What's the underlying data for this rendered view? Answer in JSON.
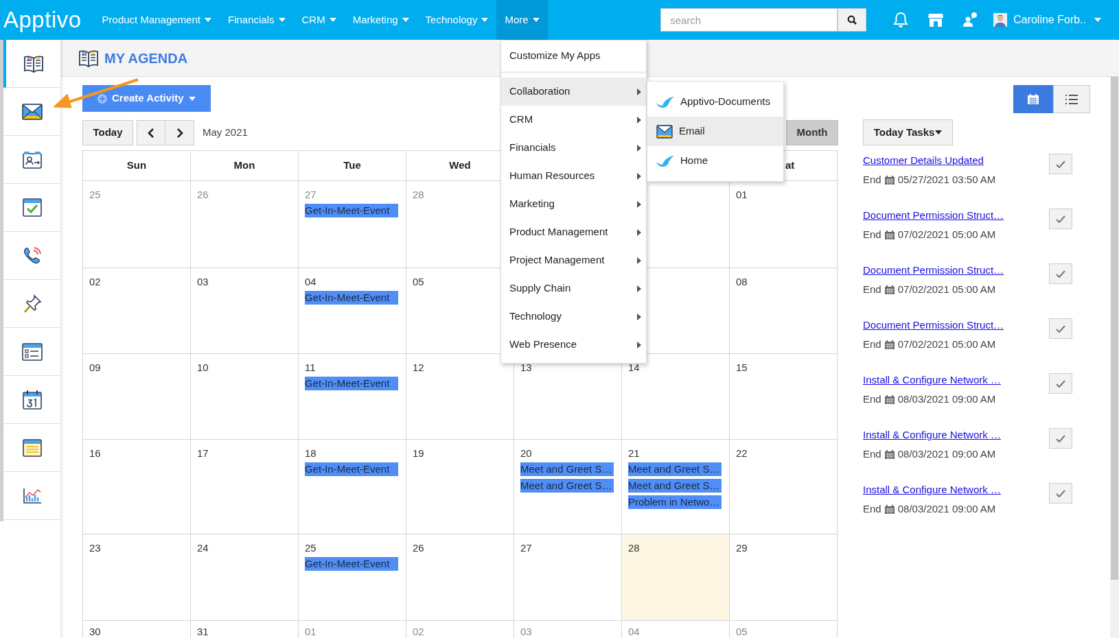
{
  "top_bar": {
    "logo": "Apptivo",
    "nav": [
      {
        "label": "Product Management",
        "selected": false
      },
      {
        "label": "Financials",
        "selected": false
      },
      {
        "label": "CRM",
        "selected": false
      },
      {
        "label": "Marketing",
        "selected": false
      },
      {
        "label": "Technology",
        "selected": false
      },
      {
        "label": "More",
        "selected": true
      }
    ],
    "search": {
      "placeholder": "search"
    },
    "user": "Caroline Forb.."
  },
  "sidebar": {
    "items": [
      {
        "kind": "book",
        "selected": true
      },
      {
        "kind": "mail",
        "selected": false
      },
      {
        "kind": "contacts",
        "selected": false
      },
      {
        "kind": "task",
        "selected": false
      },
      {
        "kind": "phone",
        "selected": false
      },
      {
        "kind": "pin",
        "selected": false
      },
      {
        "kind": "form",
        "selected": false
      },
      {
        "kind": "calendar",
        "selected": false
      },
      {
        "kind": "notepad",
        "selected": false
      },
      {
        "kind": "chart",
        "selected": false
      }
    ]
  },
  "page_title": "MY AGENDA",
  "toolbar": {
    "create_button": "Create Activity",
    "today_button": "Today",
    "period": "May 2021",
    "view_button": "Month"
  },
  "calendar": {
    "weekdays": [
      {
        "label": "Sun"
      },
      {
        "label": "Mon"
      },
      {
        "label": "Tue"
      },
      {
        "label": "Wed"
      },
      {
        "kind": "sat",
        "label": "at"
      }
    ],
    "weeks": [
      [
        {
          "date": "25",
          "muted": true
        },
        {
          "date": "26",
          "muted": true
        },
        {
          "date": "27",
          "muted": true,
          "events": [
            "Get-In-Meet-Event"
          ]
        },
        {
          "date": "28",
          "muted": true
        },
        {
          "kind": "sat",
          "date": "01",
          "muted": false
        }
      ],
      [
        {
          "date": "02",
          "muted": false
        },
        {
          "date": "03",
          "muted": false
        },
        {
          "date": "04",
          "muted": false,
          "events": [
            "Get-In-Meet-Event"
          ]
        },
        {
          "date": "05",
          "muted": false
        },
        {
          "kind": "sat",
          "date": "08",
          "muted": false
        }
      ],
      [
        {
          "date": "09",
          "muted": false
        },
        {
          "date": "10",
          "muted": false
        },
        {
          "date": "11",
          "muted": false,
          "events": [
            "Get-In-Meet-Event"
          ]
        },
        {
          "date": "12",
          "muted": false
        },
        {
          "date": "13",
          "muted": false
        },
        {
          "date": "14",
          "muted": false
        },
        {
          "date": "15",
          "muted": false
        }
      ],
      [
        {
          "date": "16",
          "muted": false
        },
        {
          "date": "17",
          "muted": false
        },
        {
          "date": "18",
          "muted": false,
          "events": [
            "Get-In-Meet-Event"
          ]
        },
        {
          "date": "19",
          "muted": false
        },
        {
          "date": "20",
          "muted": false,
          "events": [
            "Meet and Greet S…",
            "Meet and Greet S…"
          ]
        },
        {
          "date": "21",
          "muted": false,
          "events": [
            "Meet and Greet S…",
            "Meet and Greet S…",
            "Problem in Netwo…"
          ]
        },
        {
          "date": "22",
          "muted": false
        }
      ],
      [
        {
          "date": "23",
          "muted": false
        },
        {
          "date": "24",
          "muted": false
        },
        {
          "date": "25",
          "muted": false,
          "events": [
            "Get-In-Meet-Event"
          ]
        },
        {
          "date": "26",
          "muted": false
        },
        {
          "date": "27",
          "muted": false
        },
        {
          "date": "28",
          "muted": false,
          "today": true
        },
        {
          "date": "29",
          "muted": false
        }
      ],
      [
        {
          "date": "30",
          "muted": false
        },
        {
          "date": "31",
          "muted": false
        },
        {
          "date": "01",
          "muted": true
        },
        {
          "date": "02",
          "muted": true
        },
        {
          "date": "03",
          "muted": true
        },
        {
          "date": "04",
          "muted": true
        },
        {
          "date": "05",
          "muted": true
        }
      ]
    ]
  },
  "tasks_panel": {
    "views": [
      {
        "kind": "calendar",
        "selected": true
      },
      {
        "kind": "list",
        "selected": false
      }
    ],
    "filter": "Today Tasks",
    "tasks": [
      {
        "title": "Customer Details Updated",
        "end_label": "End",
        "date": "05/27/2021 03:50 AM"
      },
      {
        "title": "Document Permission Struct…",
        "end_label": "End",
        "date": "07/02/2021 05:00 AM"
      },
      {
        "title": "Document Permission Struct…",
        "end_label": "End",
        "date": "07/02/2021 05:00 AM"
      },
      {
        "title": "Document Permission Struct…",
        "end_label": "End",
        "date": "07/02/2021 05:00 AM"
      },
      {
        "title": "Install & Configure Network …",
        "end_label": "End",
        "date": "08/03/2021 09:00 AM"
      },
      {
        "title": "Install & Configure Network …",
        "end_label": "End",
        "date": "08/03/2021 09:00 AM"
      },
      {
        "title": "Install & Configure Network …",
        "end_label": "End",
        "date": "08/03/2021 09:00 AM"
      }
    ]
  },
  "more_menu": {
    "items": [
      {
        "label": "Customize My Apps",
        "has_submenu": false,
        "selected": false
      },
      {
        "label": "Collaboration",
        "has_submenu": true,
        "selected": true
      },
      {
        "label": "CRM",
        "has_submenu": true,
        "selected": false
      },
      {
        "label": "Financials",
        "has_submenu": true,
        "selected": false
      },
      {
        "label": "Human Resources",
        "has_submenu": true,
        "selected": false
      },
      {
        "label": "Marketing",
        "has_submenu": true,
        "selected": false
      },
      {
        "label": "Product Management",
        "has_submenu": true,
        "selected": false
      },
      {
        "label": "Project Management",
        "has_submenu": true,
        "selected": false
      },
      {
        "label": "Supply Chain",
        "has_submenu": true,
        "selected": false
      },
      {
        "label": "Technology",
        "has_submenu": true,
        "selected": false
      },
      {
        "label": "Web Presence",
        "has_submenu": true,
        "selected": false
      }
    ],
    "submenu": [
      {
        "label": "Apptivo-Documents",
        "kind": "leaf",
        "selected": false
      },
      {
        "label": "Email",
        "kind": "mail",
        "selected": true
      },
      {
        "label": "Home",
        "kind": "leaf",
        "selected": false
      }
    ]
  }
}
